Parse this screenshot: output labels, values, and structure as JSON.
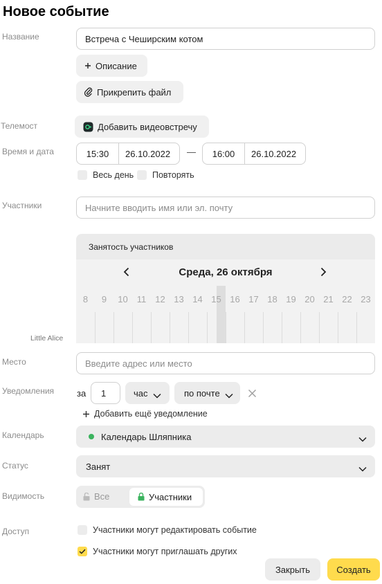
{
  "title": "Новое событие",
  "labels": {
    "name": "Название",
    "telemost": "Телемост",
    "datetime": "Время и дата",
    "participants": "Участники",
    "place": "Место",
    "notifications": "Уведомления",
    "calendar": "Календарь",
    "status": "Статус",
    "visibility": "Видимость",
    "access": "Доступ"
  },
  "name_value": "Встреча с Чеширским котом",
  "description_button": "Описание",
  "attach_button": "Прикрепить файл",
  "video_button": "Добавить видеовстречу",
  "time": {
    "start_time": "15:30",
    "start_date": "26.10.2022",
    "dash": "—",
    "end_time": "16:00",
    "end_date": "26.10.2022",
    "all_day": "Весь день",
    "repeat": "Повторять"
  },
  "participants_placeholder": "Начните вводить имя или эл. почту",
  "schedule": {
    "header": "Занятость участников",
    "date": "Среда, 26 октября",
    "hours": [
      "8",
      "9",
      "10",
      "11",
      "12",
      "13",
      "14",
      "15",
      "16",
      "17",
      "18",
      "19",
      "20",
      "21",
      "22",
      "23"
    ],
    "current_hour": "15",
    "person": "Little Alice"
  },
  "place_placeholder": "Введите адрес или место",
  "notification": {
    "prefix": "за",
    "amount": "1",
    "unit": "час",
    "method": "по почте",
    "add_label": "Добавить ещё уведомление"
  },
  "calendar": {
    "name": "Календарь Шляпника",
    "dot_color": "#3bb35e"
  },
  "status_value": "Занят",
  "visibility": {
    "all": "Все",
    "participants": "Участники",
    "selected": "participants"
  },
  "access": {
    "can_edit": "Участники могут редактировать событие",
    "can_edit_checked": false,
    "can_invite": "Участники могут приглашать других",
    "can_invite_checked": true
  },
  "buttons": {
    "close": "Закрыть",
    "create": "Создать"
  },
  "colors": {
    "accent": "#ffdb4d",
    "lock_green": "#3bb35e"
  }
}
